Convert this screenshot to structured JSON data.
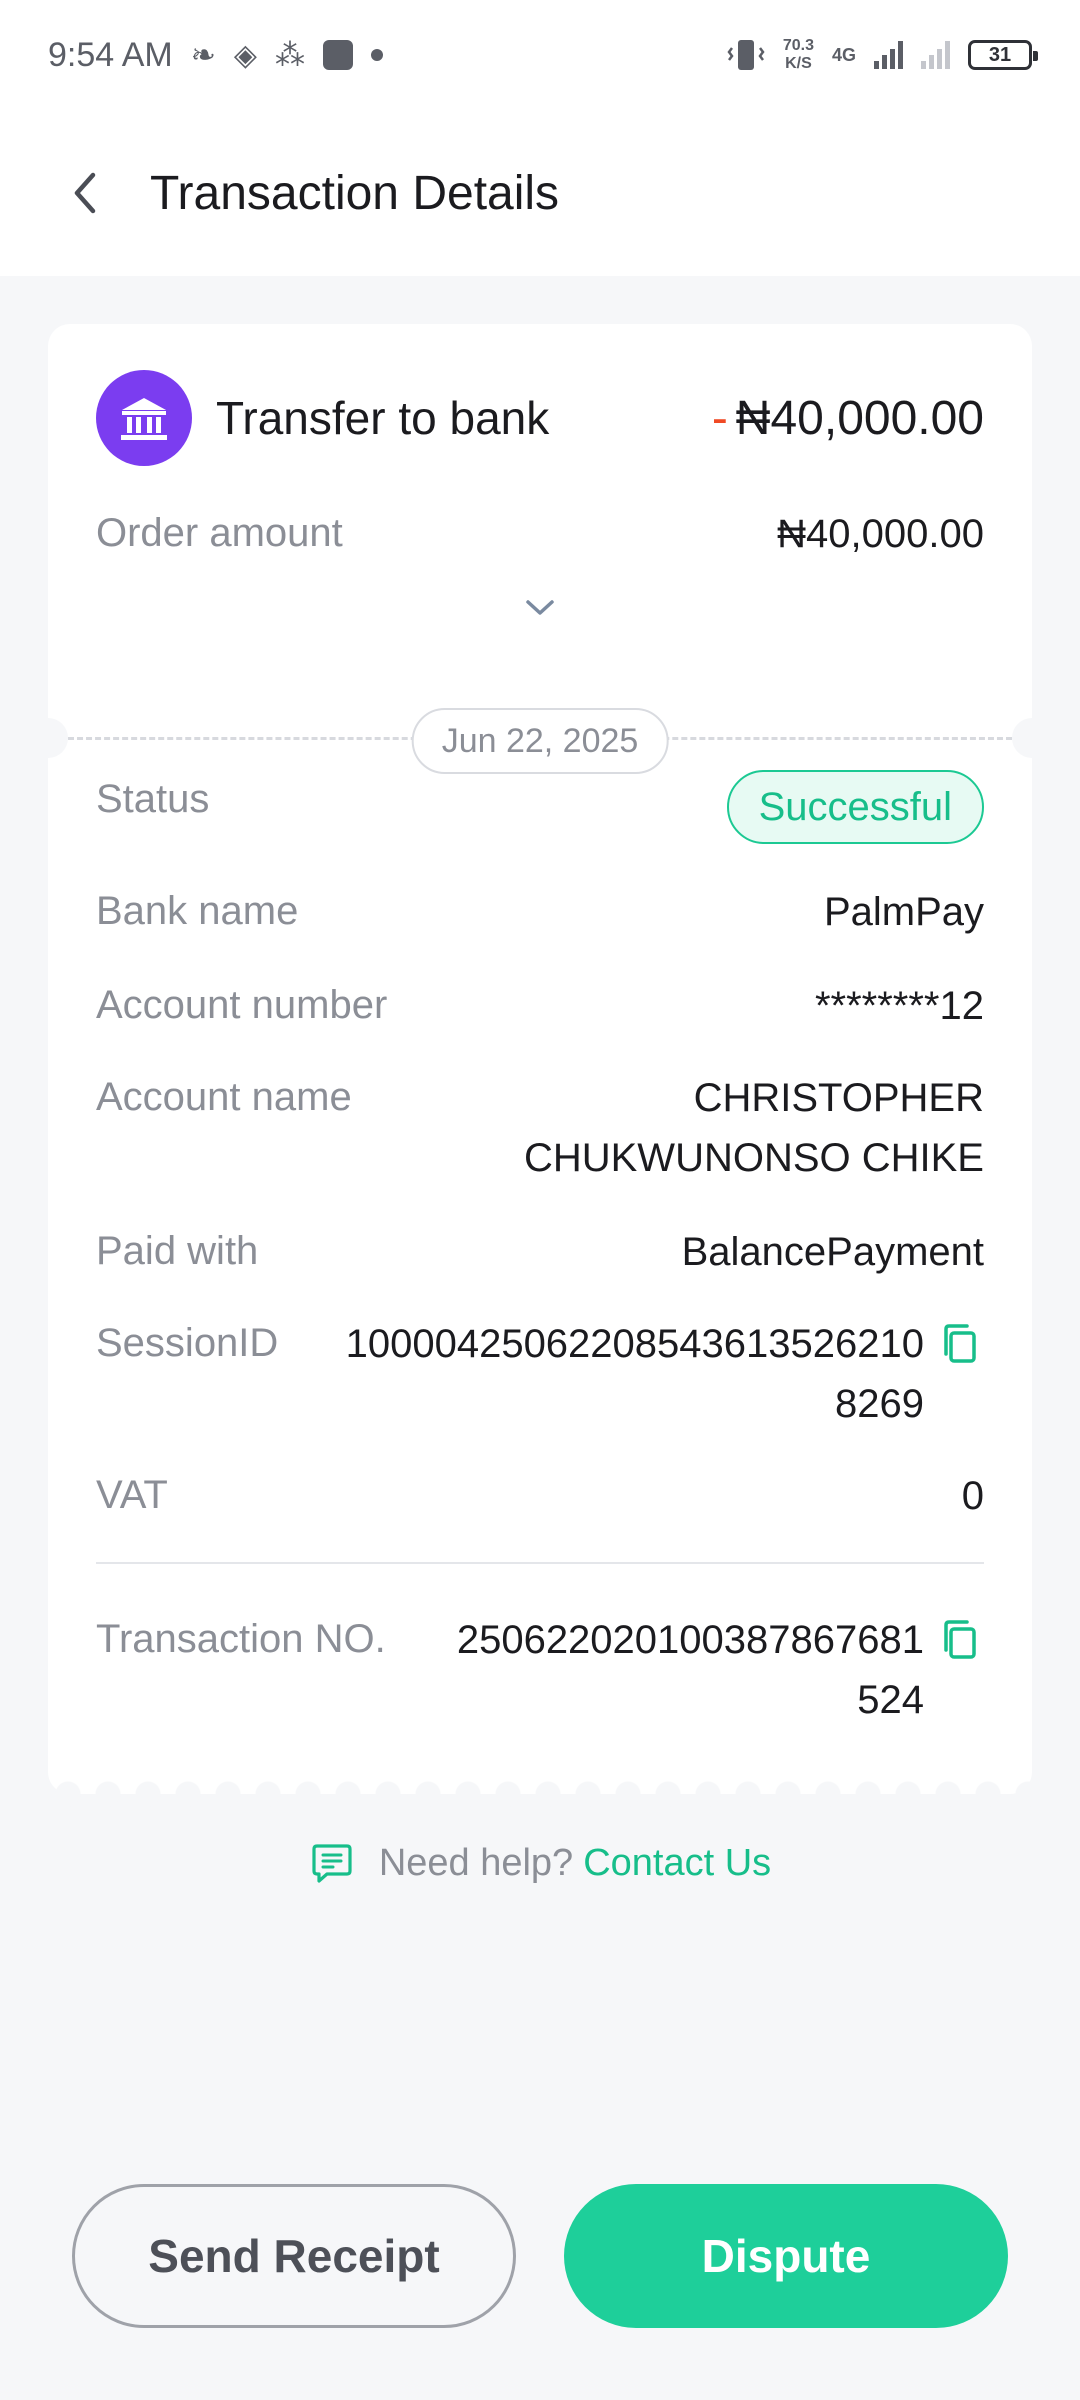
{
  "status_bar": {
    "time": "9:54 AM",
    "speed_value": "70.3",
    "speed_unit": "K/S",
    "network": "4G",
    "battery": "31"
  },
  "header": {
    "title": "Transaction Details",
    "back_icon": "chevron-left-icon"
  },
  "transaction": {
    "type": "Transfer to bank",
    "icon": "bank-icon",
    "sign": "-",
    "amount": "₦40,000.00",
    "order_amount_label": "Order amount",
    "order_amount": "₦40,000.00",
    "date": "Jun 22, 2025"
  },
  "details": {
    "status_label": "Status",
    "status": "Successful",
    "bank_name_label": "Bank name",
    "bank_name": "PalmPay",
    "account_number_label": "Account number",
    "account_number": "********12",
    "account_name_label": "Account name",
    "account_name_line1": "CHRISTOPHER",
    "account_name_line2": "CHUKWUNONSO CHIKE",
    "paid_with_label": "Paid with",
    "paid_with": "BalancePayment",
    "session_id_label": "SessionID",
    "session_id_line1": "100004250622085436135262​10",
    "session_id_line2": "8269",
    "vat_label": "VAT",
    "vat": "0",
    "transaction_no_label": "Transaction NO.",
    "transaction_no_line1": "25062202010038786768​1",
    "transaction_no_line2": "524"
  },
  "help": {
    "text": "Need help?",
    "link": "Contact Us"
  },
  "actions": {
    "send_receipt": "Send Receipt",
    "dispute": "Dispute"
  },
  "colors": {
    "accent": "#1ecf9a",
    "debit": "#f04a25",
    "bank_icon_bg": "#7b3df0"
  }
}
